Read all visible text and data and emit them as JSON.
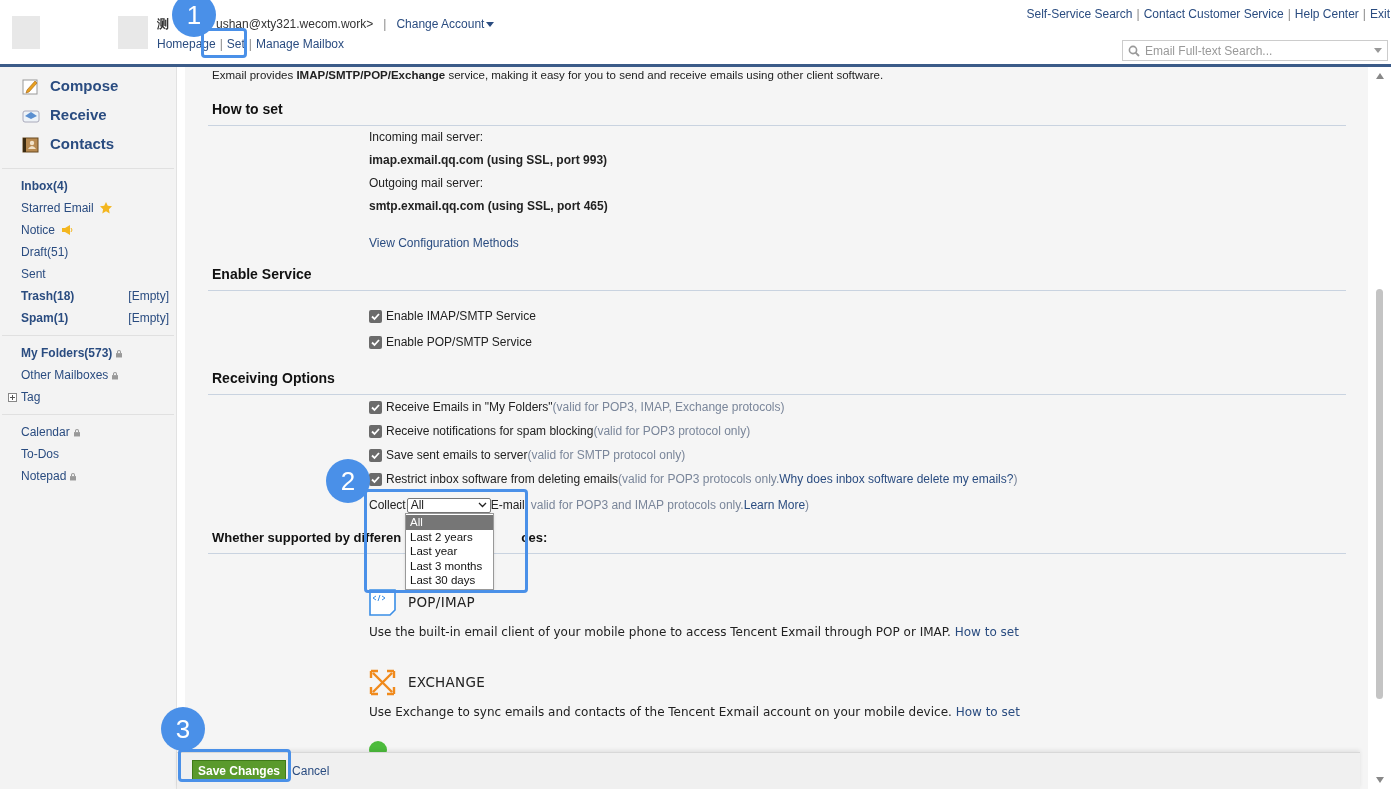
{
  "header": {
    "account_name": "测",
    "account_email": "ushan@xty321.wecom.work>",
    "separator": "|",
    "change_account": "Change Account",
    "nav_links": [
      "Homepage",
      "Set",
      "Manage Mailbox"
    ],
    "top_links": [
      "Self-Service Search",
      "Contact Customer Service",
      "Help Center",
      "Exit"
    ],
    "search": {
      "placeholder": "Email Full-text Search..."
    }
  },
  "sidebar": {
    "actions": [
      {
        "label": "Compose",
        "kind": "compose"
      },
      {
        "label": "Receive",
        "kind": "receive"
      },
      {
        "label": "Contacts",
        "kind": "contacts"
      }
    ],
    "groups": [
      [
        {
          "kind": "plain",
          "label": "Inbox(4)",
          "bold": true
        },
        {
          "kind": "starred",
          "label": "Starred Email",
          "bold": false
        },
        {
          "kind": "notice",
          "label": "Notice",
          "bold": false
        },
        {
          "kind": "plain",
          "label": "Draft(51)",
          "bold": false
        },
        {
          "kind": "plain",
          "label": "Sent",
          "bold": false
        },
        {
          "kind": "plain",
          "label": "Trash(18)",
          "bold": true,
          "action": "[Empty]"
        },
        {
          "kind": "plain",
          "label": "Spam(1)",
          "bold": true,
          "action": "[Empty]"
        }
      ],
      [
        {
          "kind": "locked",
          "label": "My Folders(573)",
          "bold": true
        },
        {
          "kind": "locked",
          "label": "Other Mailboxes",
          "bold": false
        },
        {
          "kind": "tree",
          "label": "Tag",
          "bold": false,
          "expanded": false
        }
      ],
      [
        {
          "kind": "locked",
          "label": "Calendar",
          "bold": false
        },
        {
          "kind": "plain",
          "label": "To-Dos",
          "bold": false
        },
        {
          "kind": "locked",
          "label": "Notepad",
          "bold": false
        }
      ]
    ]
  },
  "content": {
    "intro": "Exmail provides **IMAP/SMTP/POP/Exchange** service, making it easy for you to send and receive emails using other client software.",
    "how_to_set": {
      "heading": "How to set",
      "lines": [
        {
          "text": "Incoming mail server:",
          "bold": false
        },
        {
          "text": "imap.exmail.qq.com (using SSL, port 993)",
          "bold": true
        },
        {
          "text": "Outgoing mail server:",
          "bold": false
        },
        {
          "text": "smtp.exmail.qq.com (using SSL, port 465)",
          "bold": true
        }
      ],
      "link": "View Configuration Methods"
    },
    "enable_service": {
      "heading": "Enable Service",
      "options": [
        {
          "label": "Enable IMAP/SMTP Service",
          "checked": true
        },
        {
          "label": "Enable POP/SMTP Service",
          "checked": true
        }
      ]
    },
    "receiving_options": {
      "heading": "Receiving Options",
      "options": [
        {
          "kind": "checkbox",
          "label": "Receive Emails in \"My Folders\"",
          "checked": true,
          "note": "(valid for POP3, IMAP, Exchange protocols)"
        },
        {
          "kind": "checkbox",
          "label": "Receive notifications for spam blocking",
          "checked": true,
          "note": "(valid for POP3 protocol only)"
        },
        {
          "kind": "checkbox",
          "label": "Save sent emails to server",
          "checked": true,
          "note": "(valid for SMTP protocol only)"
        },
        {
          "kind": "checkbox",
          "label": "Restrict inbox software from deleting emails",
          "checked": true,
          "note": "(valid for POP3 protocols only.",
          "link": "Why does inbox software delete my emails?",
          "note_end": ")"
        },
        {
          "kind": "select",
          "prefix": "Collect",
          "value": "All",
          "suffix": "E-mail",
          "note": "valid for POP3 and IMAP protocols only.",
          "link": "Learn More",
          "note_end": ")",
          "expanded": true,
          "options": [
            {
              "label": "All",
              "selected": true
            },
            {
              "label": "Last 2 years",
              "selected": false
            },
            {
              "label": "Last year",
              "selected": false
            },
            {
              "label": "Last 3 months",
              "selected": false
            },
            {
              "label": "Last 30 days",
              "selected": false
            }
          ]
        }
      ]
    },
    "devices": {
      "heading_start": "Whether supported by differen",
      "heading_end": "ces:",
      "items": [
        {
          "kind": "pop",
          "title": "POP/IMAP",
          "description": "Use the built-in email client of your mobile phone to access Tencent Exmail through POP or IMAP.",
          "link": "How to set"
        },
        {
          "kind": "exchange",
          "title": "EXCHANGE",
          "description": "Use Exchange to sync emails and contacts of the Tencent Exmail account on your mobile device.",
          "link": "How to set"
        }
      ]
    }
  },
  "footer": {
    "save": "Save Changes",
    "cancel": "Cancel"
  },
  "annotations": [
    "1",
    "2",
    "3"
  ]
}
